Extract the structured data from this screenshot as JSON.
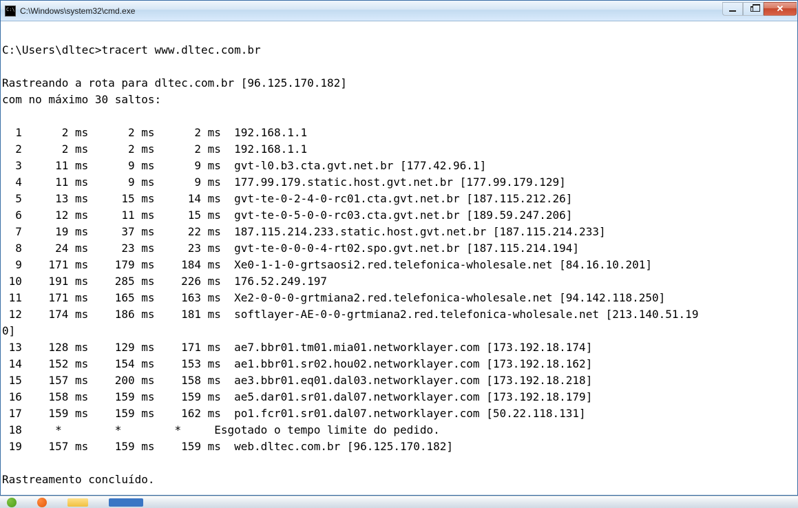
{
  "window": {
    "title": "C:\\Windows\\system32\\cmd.exe"
  },
  "terminal": {
    "prompt": "C:\\Users\\dltec>",
    "command": "tracert www.dltec.com.br",
    "trace_header_1": "Rastreando a rota para dltec.com.br [96.125.170.182]",
    "trace_header_2": "com no máximo 30 saltos:",
    "hops": [
      {
        "n": "1",
        "t1": "2 ms",
        "t2": "2 ms",
        "t3": "2 ms",
        "host": "192.168.1.1"
      },
      {
        "n": "2",
        "t1": "2 ms",
        "t2": "2 ms",
        "t3": "2 ms",
        "host": "192.168.1.1"
      },
      {
        "n": "3",
        "t1": "11 ms",
        "t2": "9 ms",
        "t3": "9 ms",
        "host": "gvt-l0.b3.cta.gvt.net.br [177.42.96.1]"
      },
      {
        "n": "4",
        "t1": "11 ms",
        "t2": "9 ms",
        "t3": "9 ms",
        "host": "177.99.179.static.host.gvt.net.br [177.99.179.129]"
      },
      {
        "n": "5",
        "t1": "13 ms",
        "t2": "15 ms",
        "t3": "14 ms",
        "host": "gvt-te-0-2-4-0-rc01.cta.gvt.net.br [187.115.212.26]"
      },
      {
        "n": "6",
        "t1": "12 ms",
        "t2": "11 ms",
        "t3": "15 ms",
        "host": "gvt-te-0-5-0-0-rc03.cta.gvt.net.br [189.59.247.206]"
      },
      {
        "n": "7",
        "t1": "19 ms",
        "t2": "37 ms",
        "t3": "22 ms",
        "host": "187.115.214.233.static.host.gvt.net.br [187.115.214.233]"
      },
      {
        "n": "8",
        "t1": "24 ms",
        "t2": "23 ms",
        "t3": "23 ms",
        "host": "gvt-te-0-0-0-4-rt02.spo.gvt.net.br [187.115.214.194]"
      },
      {
        "n": "9",
        "t1": "171 ms",
        "t2": "179 ms",
        "t3": "184 ms",
        "host": "Xe0-1-1-0-grtsaosi2.red.telefonica-wholesale.net [84.16.10.201]"
      },
      {
        "n": "10",
        "t1": "191 ms",
        "t2": "285 ms",
        "t3": "226 ms",
        "host": "176.52.249.197"
      },
      {
        "n": "11",
        "t1": "171 ms",
        "t2": "165 ms",
        "t3": "163 ms",
        "host": "Xe2-0-0-0-grtmiana2.red.telefonica-wholesale.net [94.142.118.250]"
      },
      {
        "n": "12",
        "t1": "174 ms",
        "t2": "186 ms",
        "t3": "181 ms",
        "host": "softlayer-AE-0-0-grtmiana2.red.telefonica-wholesale.net [213.140.51.19",
        "wrap": "0]"
      },
      {
        "n": "13",
        "t1": "128 ms",
        "t2": "129 ms",
        "t3": "171 ms",
        "host": "ae7.bbr01.tm01.mia01.networklayer.com [173.192.18.174]"
      },
      {
        "n": "14",
        "t1": "152 ms",
        "t2": "154 ms",
        "t3": "153 ms",
        "host": "ae1.bbr01.sr02.hou02.networklayer.com [173.192.18.162]"
      },
      {
        "n": "15",
        "t1": "157 ms",
        "t2": "200 ms",
        "t3": "158 ms",
        "host": "ae3.bbr01.eq01.dal03.networklayer.com [173.192.18.218]"
      },
      {
        "n": "16",
        "t1": "158 ms",
        "t2": "159 ms",
        "t3": "159 ms",
        "host": "ae5.dar01.sr01.dal07.networklayer.com [173.192.18.179]"
      },
      {
        "n": "17",
        "t1": "159 ms",
        "t2": "159 ms",
        "t3": "162 ms",
        "host": "po1.fcr01.sr01.dal07.networklayer.com [50.22.118.131]"
      },
      {
        "n": "18",
        "t1": "*",
        "t2": "*",
        "t3": "*",
        "host": "Esgotado o tempo limite do pedido."
      },
      {
        "n": "19",
        "t1": "157 ms",
        "t2": "159 ms",
        "t3": "159 ms",
        "host": "web.dltec.com.br [96.125.170.182]"
      }
    ],
    "footer": "Rastreamento concluído."
  }
}
